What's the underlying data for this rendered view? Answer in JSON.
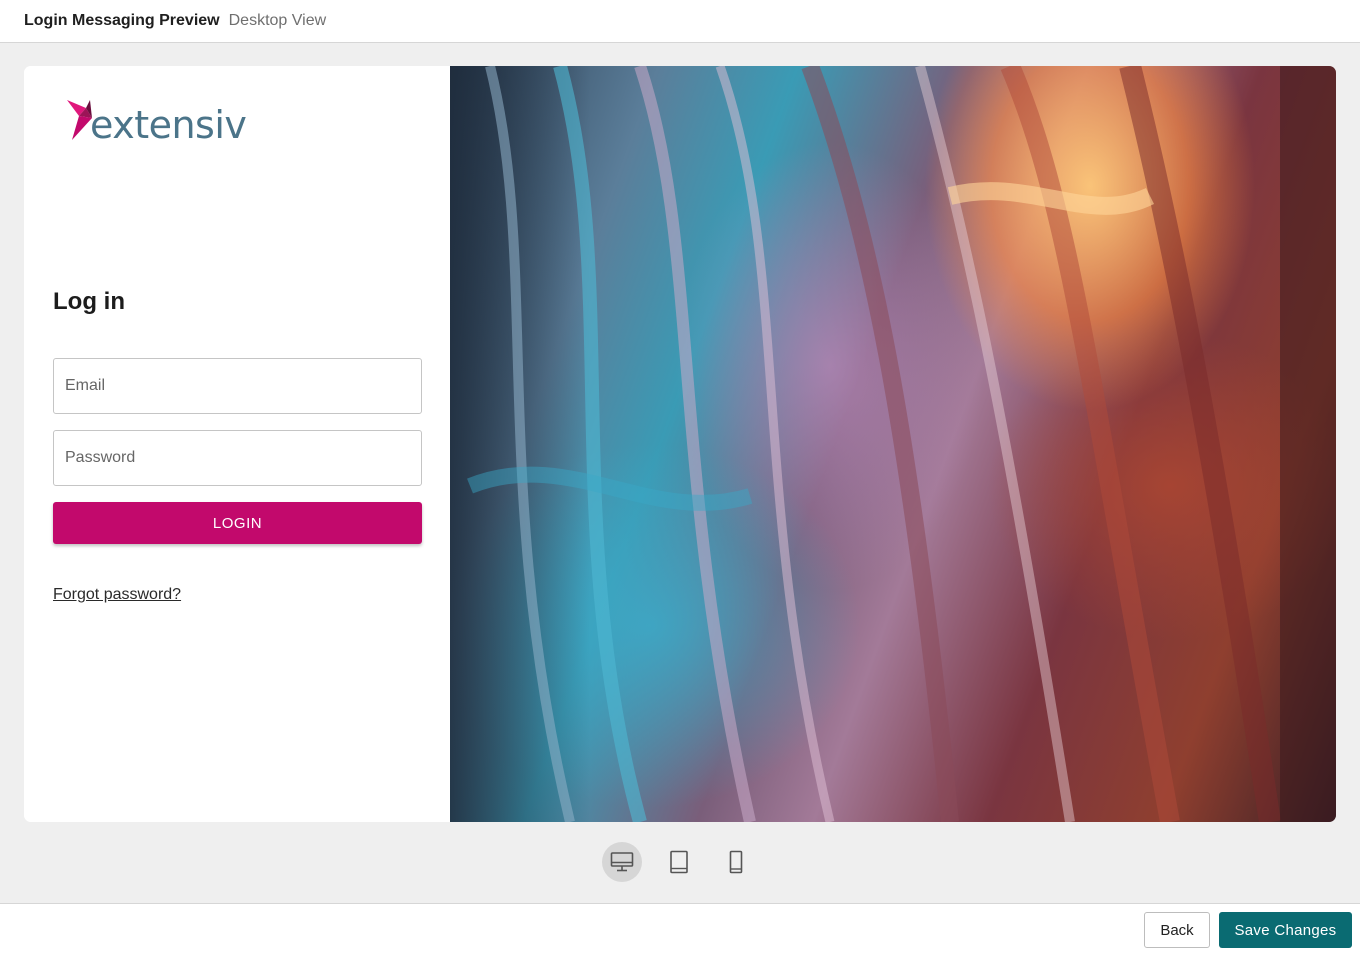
{
  "header": {
    "title": "Login Messaging Preview",
    "subtitle": "Desktop View"
  },
  "login": {
    "logo_text": "extensiv",
    "heading": "Log in",
    "email_placeholder": "Email",
    "email_value": "",
    "password_placeholder": "Password",
    "password_value": "",
    "login_button": "LOGIN",
    "forgot_link": "Forgot password?"
  },
  "device_switcher": {
    "selected": "desktop",
    "options": [
      {
        "id": "desktop",
        "icon": "desktop-monitor-icon"
      },
      {
        "id": "tablet",
        "icon": "tablet-icon"
      },
      {
        "id": "mobile",
        "icon": "mobile-phone-icon"
      }
    ]
  },
  "footer": {
    "back_label": "Back",
    "save_label": "Save Changes"
  },
  "colors": {
    "brand_magenta": "#c2096c",
    "save_teal": "#0a6b72",
    "logo_blue": "#4b7489"
  }
}
